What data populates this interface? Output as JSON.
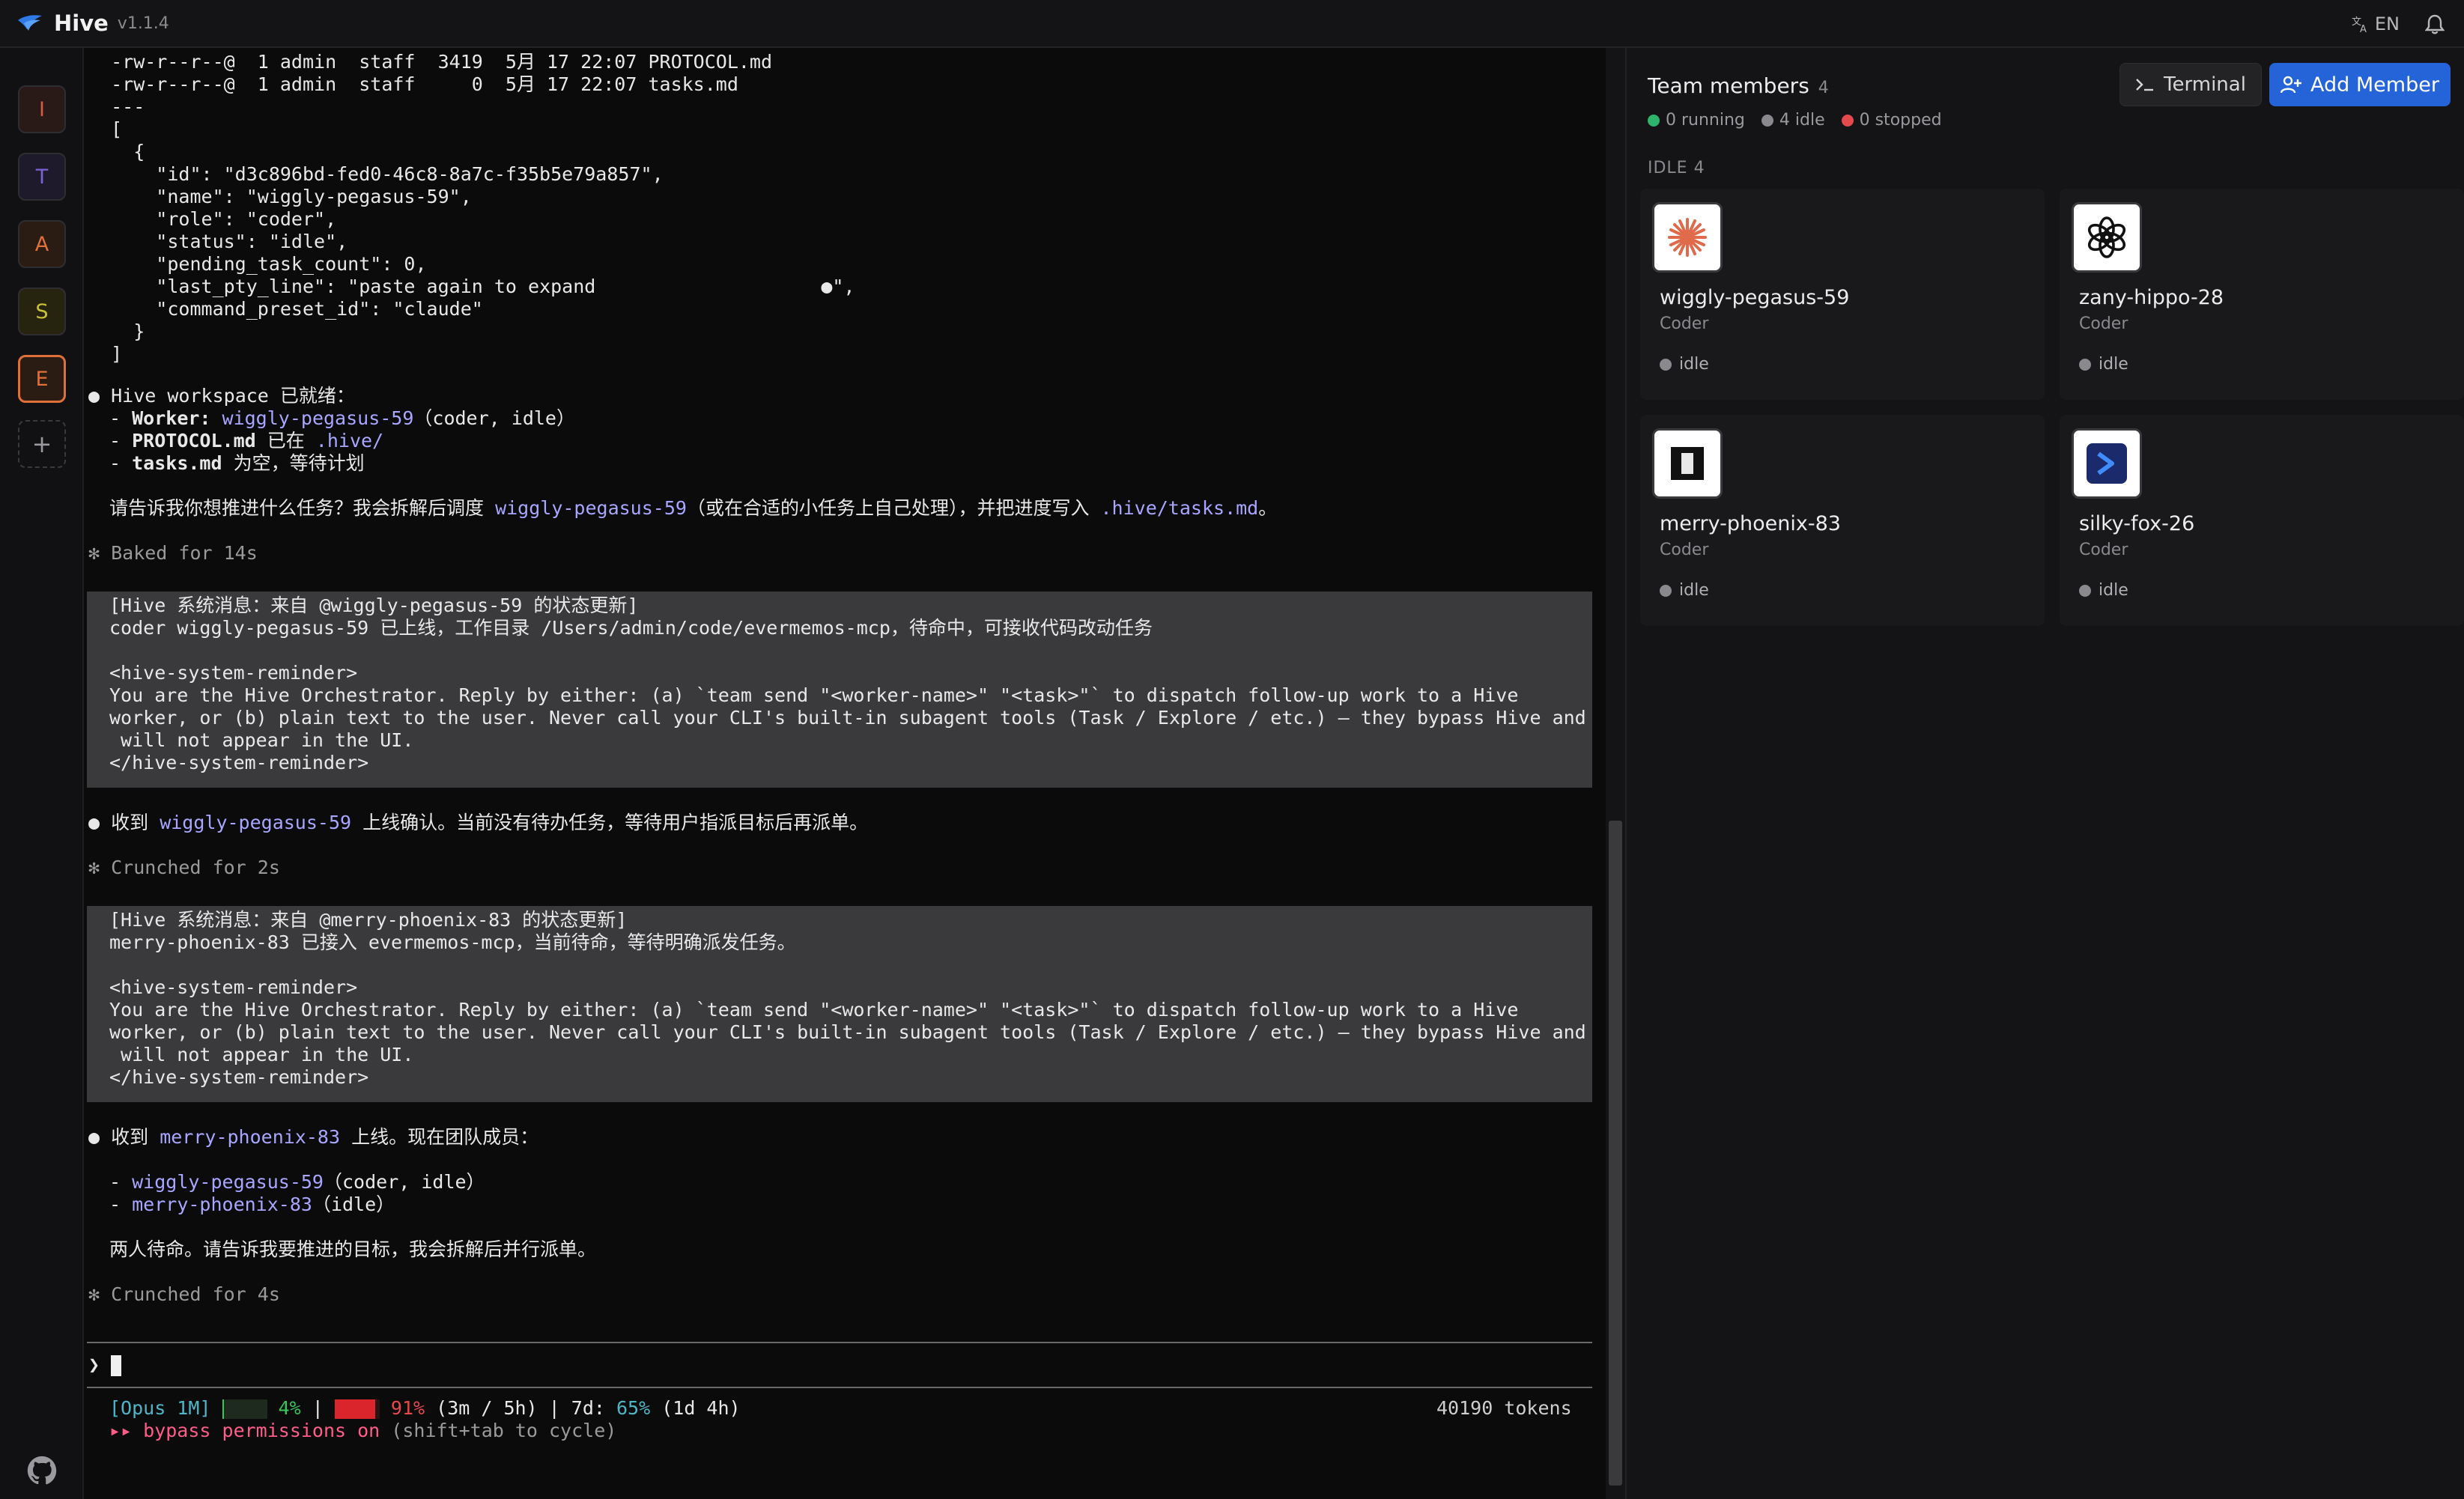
{
  "app": {
    "name": "Hive",
    "version": "v1.1.4",
    "lang": "EN"
  },
  "workspaces": [
    {
      "letter": "I",
      "color": "#d65a45",
      "bg": "#2a1a17",
      "active": false
    },
    {
      "letter": "T",
      "color": "#7b63d6",
      "bg": "#1e1a2c",
      "active": false
    },
    {
      "letter": "A",
      "color": "#e0703a",
      "bg": "#2b1c13",
      "active": false
    },
    {
      "letter": "S",
      "color": "#c9c13a",
      "bg": "#26240f",
      "active": false
    },
    {
      "letter": "E",
      "color": "#e0703a",
      "bg": "#2b1c13",
      "active": true
    }
  ],
  "workspace_add": "+",
  "terminal": {
    "lines": [
      {
        "text": "  -rw-r--r--@  1 admin  staff  3419  5月 17 22:07 PROTOCOL.md"
      },
      {
        "text": "  -rw-r--r--@  1 admin  staff     0  5月 17 22:07 tasks.md"
      },
      {
        "text": "  ---"
      },
      {
        "text": "  ["
      },
      {
        "text": "    {"
      },
      {
        "text": "      \"id\": \"d3c896bd-fed0-46c8-8a7c-f35b5e79a857\","
      },
      {
        "text": "      \"name\": \"wiggly-pegasus-59\","
      },
      {
        "text": "      \"role\": \"coder\","
      },
      {
        "text": "      \"status\": \"idle\","
      },
      {
        "text": "      \"pending_task_count\": 0,"
      },
      {
        "text": "      \"last_pty_line\": \"paste again to expand                    ●\","
      },
      {
        "text": "      \"command_preset_id\": \"claude\""
      },
      {
        "text": "    }"
      },
      {
        "text": "  ]"
      }
    ],
    "ready_title": "Hive workspace 已就绪：",
    "ready_items": [
      {
        "dash": "- ",
        "label": "Worker:",
        "link": "wiggly-pegasus-59",
        "rest": "（coder, idle）"
      },
      {
        "dash": "- ",
        "label": "PROTOCOL.md",
        "link": "",
        "mid": " 已在 ",
        "link2": ".hive/"
      },
      {
        "dash": "- ",
        "label": "tasks.md",
        "rest": " 为空，等待计划"
      }
    ],
    "ask_pre": "请告诉我你想推进什么任务？我会拆解后调度 ",
    "ask_link": "wiggly-pegasus-59",
    "ask_mid": "（或在合适的小任务上自己处理），并把进度写入 ",
    "ask_link2": ".hive/tasks.md",
    "ask_post": "。",
    "baked": "✻ Baked for 14s",
    "sys1": [
      "[Hive 系统消息：来自 @wiggly-pegasus-59 的状态更新]",
      "coder wiggly-pegasus-59 已上线，工作目录 /Users/admin/code/evermemos-mcp，待命中，可接收代码改动任务",
      "",
      "<hive-system-reminder>",
      "You are the Hive Orchestrator. Reply by either: (a) `team send \"<worker-name>\" \"<task>\"` to dispatch follow-up work to a Hive",
      "worker, or (b) plain text to the user. Never call your CLI's built-in subagent tools (Task / Explore / etc.) — they bypass Hive and",
      " will not appear in the UI.",
      "</hive-system-reminder>"
    ],
    "ack1_pre": "收到 ",
    "ack1_link": "wiggly-pegasus-59",
    "ack1_post": " 上线确认。当前没有待办任务，等待用户指派目标后再派单。",
    "crunched1": "✻ Crunched for 2s",
    "sys2": [
      "[Hive 系统消息：来自 @merry-phoenix-83 的状态更新]",
      "merry-phoenix-83 已接入 evermemos-mcp，当前待命，等待明确派发任务。",
      "",
      "<hive-system-reminder>",
      "You are the Hive Orchestrator. Reply by either: (a) `team send \"<worker-name>\" \"<task>\"` to dispatch follow-up work to a Hive",
      "worker, or (b) plain text to the user. Never call your CLI's built-in subagent tools (Task / Explore / etc.) — they bypass Hive and",
      " will not appear in the UI.",
      "</hive-system-reminder>"
    ],
    "ack2_pre": "收到 ",
    "ack2_link": "merry-phoenix-83",
    "ack2_post": " 上线。现在团队成员：",
    "team_line1_link": "wiggly-pegasus-59",
    "team_line1_rest": "（coder, idle）",
    "team_line2_link": "merry-phoenix-83",
    "team_line2_rest": "（idle）",
    "both_waiting": "两人待命。请告诉我要推进的目标，我会拆解后并行派单。",
    "crunched2": "✻ Crunched for 4s",
    "prompt": "❯",
    "status_model": "[Opus 1M]",
    "status_ctx_pct": "4%",
    "status_ctx_fill": 0.04,
    "status_sep": " | ",
    "status_usage_pct": "91%",
    "status_usage_fill": 0.91,
    "status_window": "(3m / 5h)",
    "status_week_label": "| 7d:",
    "status_week_pct": "65%",
    "status_week_rest": "(1d 4h)",
    "tokens": "40190 tokens",
    "bypass": "▸▸ bypass permissions on",
    "bypass_hint": " (shift+tab to cycle)"
  },
  "panel": {
    "title": "Team members",
    "count": "4",
    "stats": [
      {
        "label": "0 running",
        "color": "#2fb56b"
      },
      {
        "label": "4 idle",
        "color": "#8a8a8e"
      },
      {
        "label": "0 stopped",
        "color": "#e5484d"
      }
    ],
    "terminal_btn": "Terminal",
    "add_btn": "Add Member",
    "section": "IDLE 4",
    "members": [
      {
        "name": "wiggly-pegasus-59",
        "role": "Coder",
        "status": "idle",
        "icon": "claude-icon"
      },
      {
        "name": "zany-hippo-28",
        "role": "Coder",
        "status": "idle",
        "icon": "openai-icon"
      },
      {
        "name": "merry-phoenix-83",
        "role": "Coder",
        "status": "idle",
        "icon": "gemini-box-icon"
      },
      {
        "name": "silky-fox-26",
        "role": "Coder",
        "status": "idle",
        "icon": "cursor-prompt-icon"
      }
    ]
  }
}
